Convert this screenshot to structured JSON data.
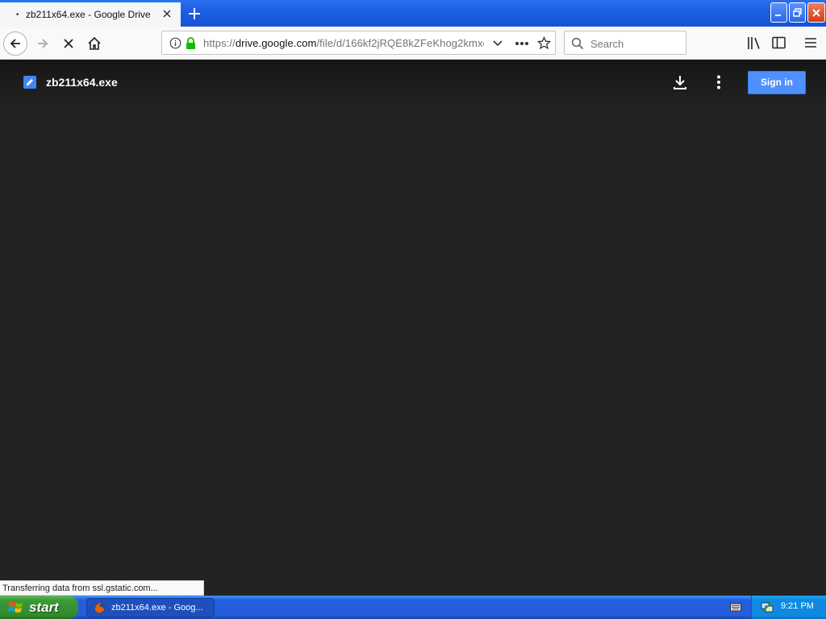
{
  "browser": {
    "tab": {
      "title": "zb211x64.exe - Google Drive"
    },
    "url": {
      "prefix": "https://",
      "host": "drive.google.com",
      "path": "/file/d/166kf2jRQE8kZFeKhog2kmxe"
    },
    "search": {
      "placeholder": "Search"
    },
    "status_text": "Transferring data from ssl.gstatic.com..."
  },
  "viewer": {
    "file_name": "zb211x64.exe",
    "sign_in_label": "Sign in"
  },
  "taskbar": {
    "start_label": "start",
    "task_label": "zb211x64.exe - Goog...",
    "clock": "9:21 PM"
  },
  "colors": {
    "viewer_background": "#232323",
    "sign_in_button": "#4d90fe",
    "taskbar_blue": "#245edb"
  }
}
